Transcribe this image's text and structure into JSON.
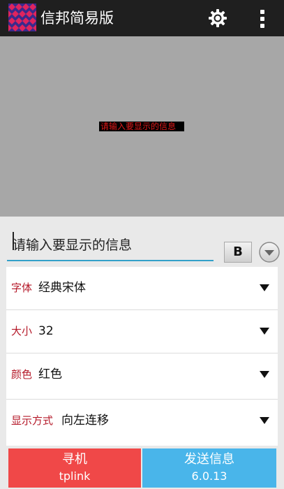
{
  "appbar": {
    "title": "信邦简易版",
    "logo_icon": "diamond-lattice-logo",
    "settings_icon": "gear-icon",
    "menu_icon": "overflow-menu-icon"
  },
  "preview": {
    "text": "请输入要显示的信息",
    "background": "#a7a7a7",
    "text_color": "#e01a1a"
  },
  "input": {
    "placeholder": "请输入要显示的信息",
    "bold_label": "B"
  },
  "settings": [
    {
      "label": "字体",
      "value": "经典宋体"
    },
    {
      "label": "大小",
      "value": "32"
    },
    {
      "label": "颜色",
      "value": "红色"
    },
    {
      "label": "显示方式",
      "value": "向左连移"
    }
  ],
  "bottom": {
    "find": {
      "line1": "寻机",
      "line2": "tplink"
    },
    "send": {
      "line1": "发送信息",
      "line2": "6.0.13"
    }
  },
  "colors": {
    "appbar": "#1f1f1f",
    "label": "#b51a2a",
    "find_button": "#f04848",
    "send_button": "#49b5ea",
    "input_underline": "#33a0c9"
  }
}
